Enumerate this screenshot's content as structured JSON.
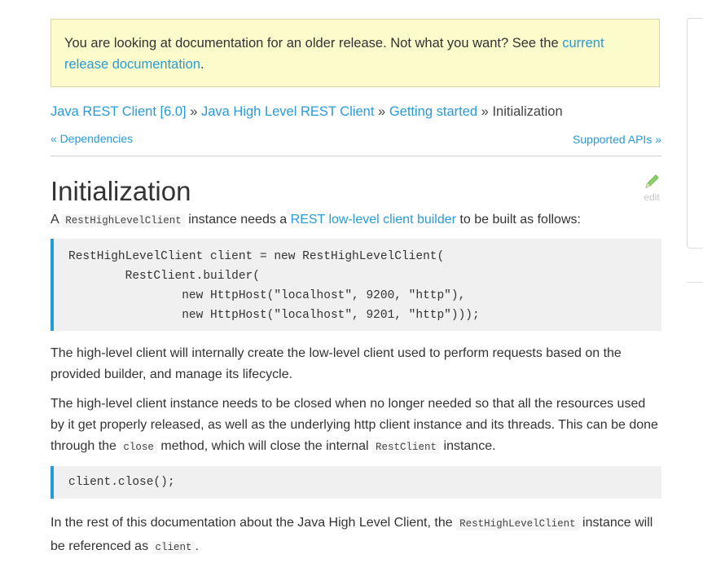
{
  "notice": {
    "text": "You are looking at documentation for an older release. Not what you want? See the ",
    "link": "current release documentation",
    "suffix": "."
  },
  "breadcrumb": {
    "items": [
      "Java REST Client [6.0]",
      "Java High Level REST Client",
      "Getting started"
    ],
    "separator": "»",
    "current": "Initialization"
  },
  "nav": {
    "prev": "« Dependencies",
    "next": "Supported APIs »"
  },
  "page": {
    "title": "Initialization",
    "edit_label": "edit"
  },
  "intro": {
    "pre": "A ",
    "code": "RestHighLevelClient",
    "mid": " instance needs a ",
    "link": "REST low-level client builder",
    "post": " to be built as follows:"
  },
  "code1": "RestHighLevelClient client = new RestHighLevelClient(\n        RestClient.builder(\n                new HttpHost(\"localhost\", 9200, \"http\"),\n                new HttpHost(\"localhost\", 9201, \"http\")));",
  "para1": "The high-level client will internally create the low-level client used to perform requests based on the provided builder, and manage its lifecycle.",
  "para2": {
    "pre": "The high-level client instance needs to be closed when no longer needed so that all the resources used by it get properly released, as well as the underlying http client instance and its threads. This can be done through the ",
    "code1": "close",
    "mid": " method, which will close the internal ",
    "code2": "RestClient",
    "post": " instance."
  },
  "code2": "client.close();",
  "para3": {
    "pre": "In the rest of this documentation about the Java High Level Client, the ",
    "code1": "RestHighLevelClient",
    "mid": " instance will be referenced as ",
    "code2": "client",
    "post": "."
  },
  "colors": {
    "link": "#2a9ad6",
    "notice_bg": "#fbfbcc",
    "code_bg": "#f0f0f0",
    "code_border": "#2a9ad6",
    "edit_icon": "#8fd16a"
  }
}
